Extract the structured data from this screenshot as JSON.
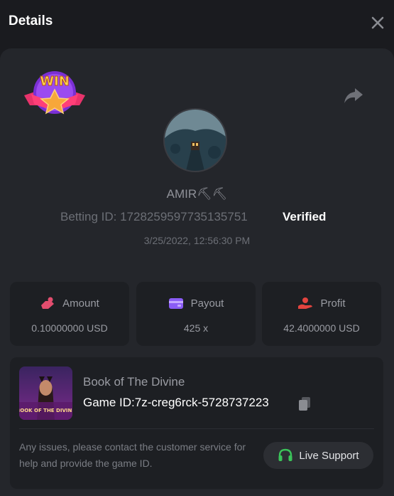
{
  "header": {
    "title": "Details",
    "close_icon": "close-icon"
  },
  "badge": {
    "text": "WIN",
    "icon": "win-star-badge-icon"
  },
  "share_icon": "share-icon",
  "user": {
    "name": "AMIR⛏⛏",
    "betting_id": "Betting ID: 1728259597735135751",
    "verified": "Verified",
    "datetime": "3/25/2022, 12:56:30 PM"
  },
  "stats": [
    {
      "label": "Amount",
      "value": "0.10000000 USD",
      "icon": "amount-icon",
      "color": "#e24d6e"
    },
    {
      "label": "Payout",
      "value": "425 x",
      "icon": "wallet-icon",
      "color": "#8a5cf6"
    },
    {
      "label": "Profit",
      "value": "42.4000000 USD",
      "icon": "profit-icon",
      "color": "#e2443f"
    }
  ],
  "game": {
    "name": "Book of The Divine",
    "id": "Game ID:7z-creg6rck-5728737223",
    "thumb_caption": "BOOK OF THE DIVINE"
  },
  "help_text": "Any issues, please contact the customer service for help and provide the game ID.",
  "support": {
    "label": "Live Support",
    "icon": "headset-icon",
    "color": "#3bc45a"
  }
}
